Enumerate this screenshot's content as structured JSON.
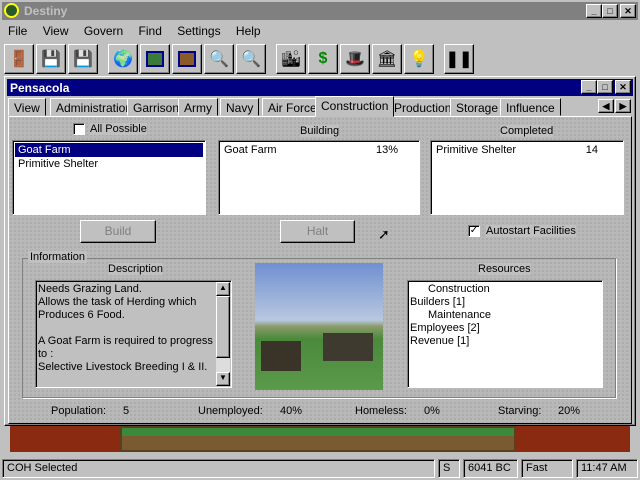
{
  "app": {
    "title": "Destiny",
    "menu": [
      "File",
      "View",
      "Govern",
      "Find",
      "Settings",
      "Help"
    ]
  },
  "toolbar": [
    "exit-icon",
    "save-icon",
    "load-icon",
    "globe-icon",
    "map-icon",
    "city-map-icon",
    "zoom-in-icon",
    "zoom-out-icon",
    "city-icon",
    "money-icon",
    "hat-icon",
    "capitol-icon",
    "bulb-icon",
    "pause-icon"
  ],
  "window": {
    "title": "Pensacola",
    "tabs": [
      "View",
      "Administration",
      "Garrison",
      "Army",
      "Navy",
      "Air Force",
      "Construction",
      "Production",
      "Storage",
      "Influence"
    ],
    "active_tab": "Construction"
  },
  "construction": {
    "all_possible_label": "All Possible",
    "available": [
      "Goat Farm",
      "Primitive Shelter"
    ],
    "building_label": "Building",
    "building": [
      {
        "name": "Goat Farm",
        "value": "13%"
      }
    ],
    "completed_label": "Completed",
    "completed": [
      {
        "name": "Primitive Shelter",
        "value": "14"
      }
    ],
    "build_label": "Build",
    "halt_label": "Halt",
    "autostart_label": "Autostart Facilities"
  },
  "information": {
    "label": "Information",
    "description_label": "Description",
    "description": [
      "Needs Grazing Land.",
      "Allows the task of Herding which",
      "Produces 6 Food.",
      "",
      "A Goat Farm is required to progress",
      "to :",
      "Selective Livestock Breeding I & II."
    ],
    "resources_label": "Resources",
    "resources": [
      "Construction",
      "Builders [1]",
      "Maintenance",
      "Employees [2]",
      "Revenue [1]"
    ]
  },
  "stats": {
    "population_label": "Population:",
    "population": "5",
    "unemployed_label": "Unemployed:",
    "unemployed": "40%",
    "homeless_label": "Homeless:",
    "homeless": "0%",
    "starving_label": "Starving:",
    "starving": "20%"
  },
  "status": {
    "message": "COH Selected",
    "s": "S",
    "year": "6041 BC",
    "speed": "Fast",
    "time": "11:47 AM"
  }
}
